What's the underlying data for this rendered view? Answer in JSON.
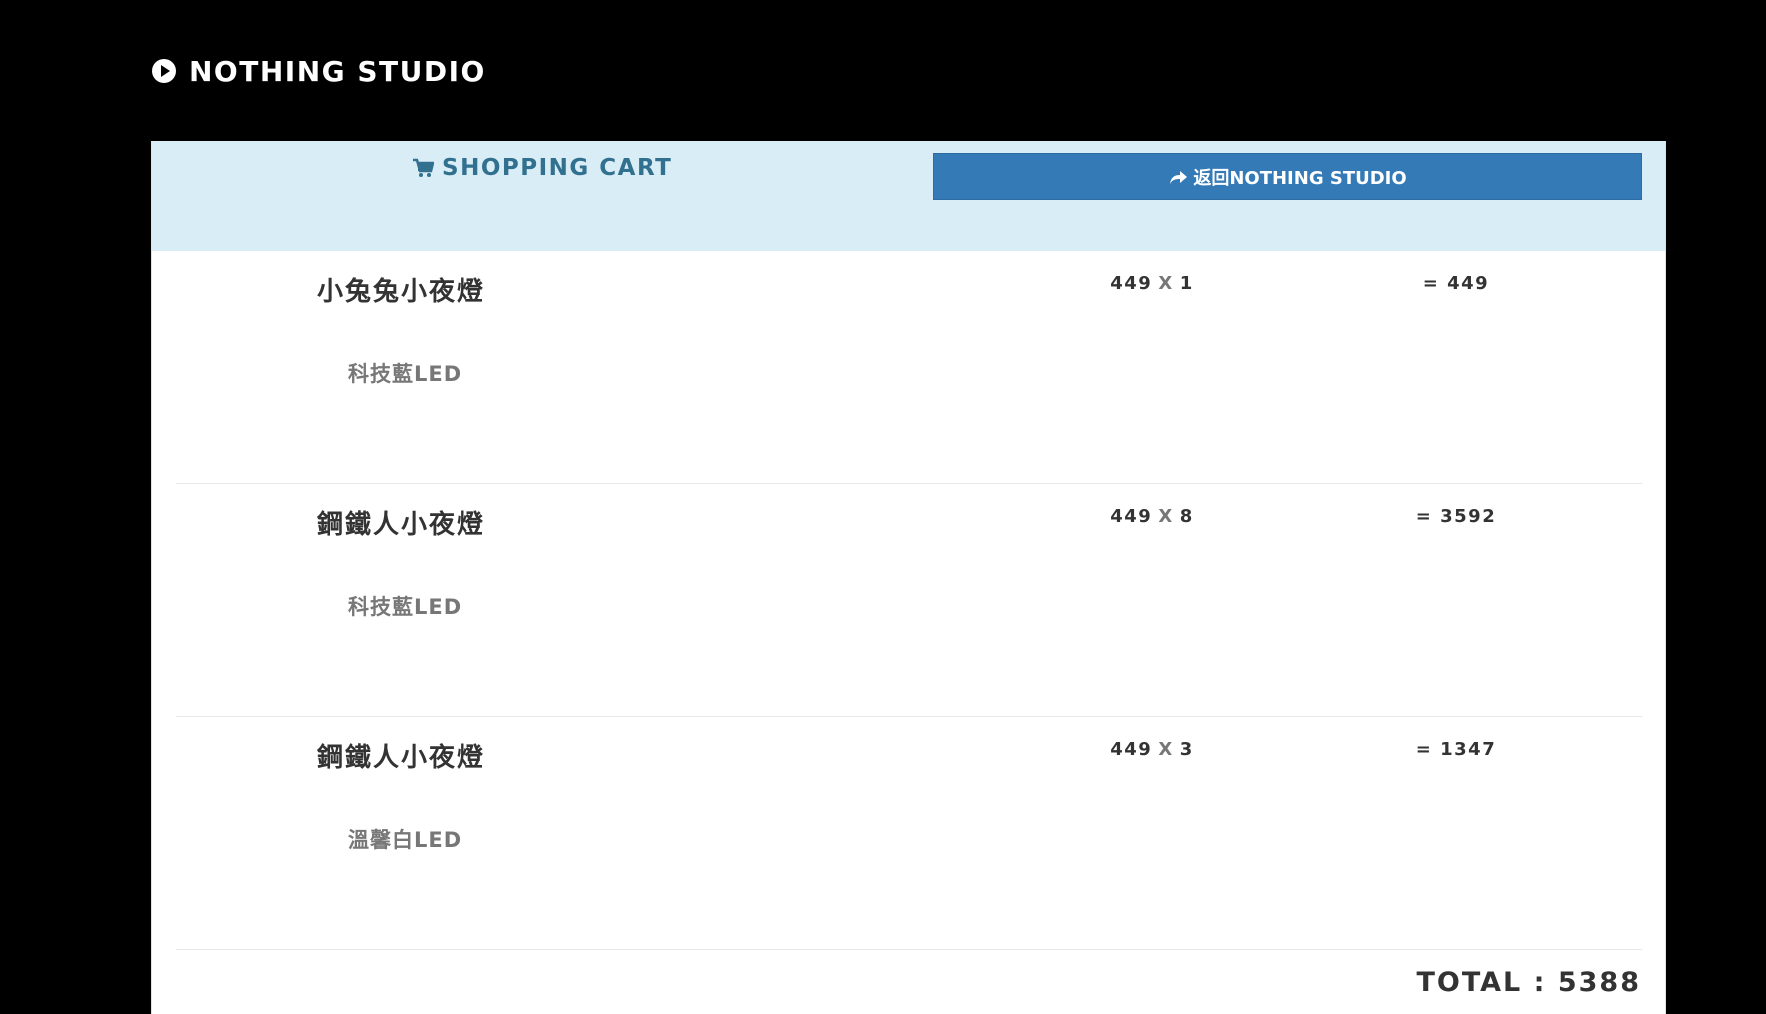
{
  "brand": {
    "icon": "play-circle-icon",
    "name": "NOTHING STUDIO"
  },
  "header": {
    "cart_icon": "shopping-cart-icon",
    "cart_title": "SHOPPING CART",
    "back_button_icon": "share-arrow-icon",
    "back_button_label": "返回NOTHING STUDIO"
  },
  "cart": {
    "items": [
      {
        "name": "小兔兔小夜燈",
        "variant": "科技藍LED",
        "price": "449",
        "times": "X",
        "qty": "1",
        "subtotal": "= 449"
      },
      {
        "name": "鋼鐵人小夜燈",
        "variant": "科技藍LED",
        "price": "449",
        "times": "X",
        "qty": "8",
        "subtotal": "= 3592"
      },
      {
        "name": "鋼鐵人小夜燈",
        "variant": "溫馨白LED",
        "price": "449",
        "times": "X",
        "qty": "3",
        "subtotal": "= 1347"
      }
    ],
    "total_label": "TOTAL : 5388"
  },
  "colors": {
    "background": "#000000",
    "header_bg": "#d9edf7",
    "header_text": "#31708f",
    "button_bg": "#337ab7"
  }
}
